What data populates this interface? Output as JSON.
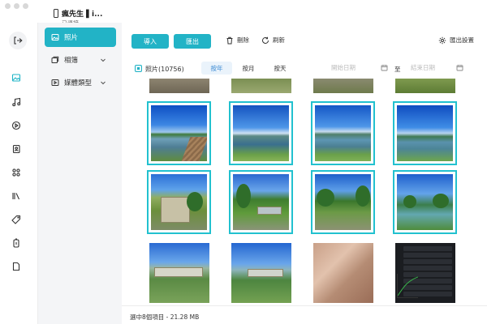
{
  "device": {
    "name": "瘋先生 ▌i...",
    "status": "已連接"
  },
  "rail": {
    "items": [
      {
        "icon": "exit-icon"
      },
      {
        "icon": "photo-icon",
        "active": true
      },
      {
        "icon": "music-icon"
      },
      {
        "icon": "video-icon"
      },
      {
        "icon": "contacts-icon"
      },
      {
        "icon": "apps-icon"
      },
      {
        "icon": "books-icon"
      },
      {
        "icon": "ringtone-icon"
      },
      {
        "icon": "backup-icon"
      },
      {
        "icon": "file-icon"
      }
    ]
  },
  "sidenav": {
    "items": [
      {
        "label": "照片",
        "icon": "photo-icon",
        "active": true
      },
      {
        "label": "相簿",
        "icon": "album-icon",
        "expandable": true
      },
      {
        "label": "媒體類型",
        "icon": "media-type-icon",
        "expandable": true
      }
    ]
  },
  "toolbar": {
    "import_label": "導入",
    "export_label": "匯出",
    "delete_label": "刪除",
    "refresh_label": "刷新",
    "export_settings_label": "匯出設置"
  },
  "filter": {
    "photos_label": "照片(10756)",
    "by_year": "按年",
    "by_month": "按月",
    "by_day": "按天",
    "start_date_placeholder": "開始日期",
    "separator": "至",
    "end_date_placeholder": "結束日期"
  },
  "footer": {
    "status": "選中8個項目 - 21.28 MB"
  },
  "colors": {
    "accent": "#22b3c6",
    "selection_border": "#22c1cf",
    "segment_active_text": "#3a8ad3"
  }
}
